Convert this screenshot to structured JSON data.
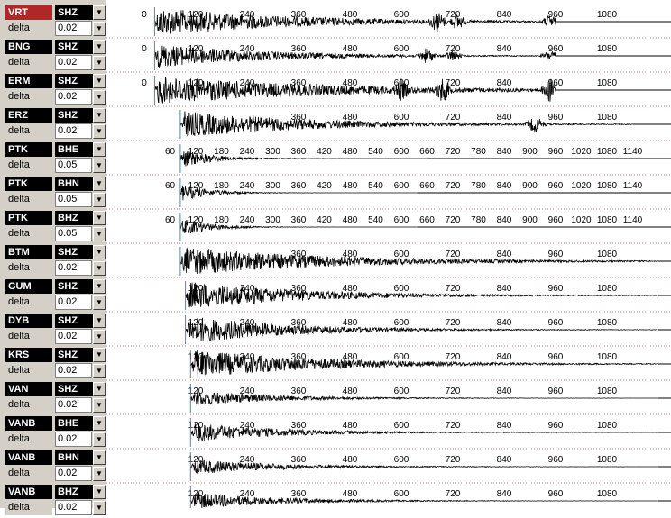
{
  "delta_label": "delta",
  "arrow_glyph": "▼",
  "channels": [
    {
      "station": "VRT",
      "component": "SHZ",
      "delta": "0.02",
      "selected": true
    },
    {
      "station": "BNG",
      "component": "SHZ",
      "delta": "0.02"
    },
    {
      "station": "ERM",
      "component": "SHZ",
      "delta": "0.02"
    },
    {
      "station": "ERZ",
      "component": "SHZ",
      "delta": "0.02"
    },
    {
      "station": "PTK",
      "component": "BHE",
      "delta": "0.05"
    },
    {
      "station": "PTK",
      "component": "BHN",
      "delta": "0.05"
    },
    {
      "station": "PTK",
      "component": "BHZ",
      "delta": "0.05"
    },
    {
      "station": "BTM",
      "component": "SHZ",
      "delta": "0.02"
    },
    {
      "station": "GUM",
      "component": "SHZ",
      "delta": "0.02"
    },
    {
      "station": "DYB",
      "component": "SHZ",
      "delta": "0.02"
    },
    {
      "station": "KRS",
      "component": "SHZ",
      "delta": "0.02"
    },
    {
      "station": "VAN",
      "component": "SHZ",
      "delta": "0.02"
    },
    {
      "station": "VANB",
      "component": "BHE",
      "delta": "0.02"
    },
    {
      "station": "VANB",
      "component": "BHN",
      "delta": "0.02"
    },
    {
      "station": "VANB",
      "component": "BHZ",
      "delta": "0.02"
    }
  ],
  "traces": [
    {
      "ticks": [
        "0",
        "120",
        "240",
        "360",
        "480",
        "600",
        "720",
        "840",
        "960",
        "1080"
      ],
      "onset": 0.02,
      "end": 0.8,
      "amp": 1.0,
      "decay": 0.55,
      "bursts": [
        [
          0.57,
          0.8
        ],
        [
          0.61,
          0.6
        ],
        [
          0.79,
          0.5
        ]
      ]
    },
    {
      "ticks": [
        "0",
        "120",
        "240",
        "360",
        "480",
        "600",
        "720",
        "840",
        "960",
        "1080"
      ],
      "onset": 0.02,
      "end": 0.8,
      "amp": 0.85,
      "decay": 0.45,
      "bursts": [
        [
          0.55,
          0.7
        ],
        [
          0.6,
          0.5
        ],
        [
          0.79,
          0.45
        ]
      ]
    },
    {
      "ticks": [
        "0",
        "120",
        "240",
        "360",
        "480",
        "600",
        "720",
        "840",
        "960",
        "1080"
      ],
      "onset": 0.02,
      "end": 0.8,
      "amp": 1.0,
      "decay": 0.7,
      "bursts": [
        [
          0.5,
          0.8
        ],
        [
          0.58,
          0.9
        ],
        [
          0.79,
          0.9
        ]
      ]
    },
    {
      "ticks": [
        "360",
        "480",
        "600",
        "720",
        "840",
        "960",
        "1080"
      ],
      "onset": 0.07,
      "end": 0.95,
      "amp": 0.95,
      "decay": 0.45,
      "bursts": [
        [
          0.76,
          0.6
        ]
      ]
    },
    {
      "ticks": [
        "60",
        "120",
        "180",
        "240",
        "300",
        "360",
        "420",
        "480",
        "540",
        "600",
        "660",
        "720",
        "780",
        "840",
        "900",
        "960",
        "1020",
        "1080",
        "1140"
      ],
      "onset": 0.07,
      "end": 0.55,
      "amp": 0.7,
      "decay": 0.2,
      "bursts": []
    },
    {
      "ticks": [
        "60",
        "120",
        "180",
        "240",
        "300",
        "360",
        "420",
        "480",
        "540",
        "600",
        "660",
        "720",
        "780",
        "840",
        "900",
        "960",
        "1020",
        "1080",
        "1140"
      ],
      "onset": 0.07,
      "end": 0.53,
      "amp": 0.6,
      "decay": 0.2,
      "bursts": []
    },
    {
      "ticks": [
        "60",
        "120",
        "180",
        "240",
        "300",
        "360",
        "420",
        "480",
        "540",
        "600",
        "660",
        "720",
        "780",
        "840",
        "900",
        "960",
        "1020",
        "1080",
        "1140"
      ],
      "onset": 0.07,
      "end": 0.53,
      "amp": 0.65,
      "decay": 0.2,
      "bursts": []
    },
    {
      "ticks": [
        "360",
        "480",
        "600",
        "720",
        "840",
        "960",
        "1080"
      ],
      "onset": 0.07,
      "end": 1.0,
      "amp": 1.0,
      "decay": 0.5,
      "bursts": []
    },
    {
      "ticks": [
        "120",
        "240",
        "360",
        "480",
        "600",
        "720",
        "840",
        "960",
        "1080"
      ],
      "onset": 0.08,
      "end": 1.0,
      "amp": 1.0,
      "decay": 0.4,
      "bursts": []
    },
    {
      "ticks": [
        "120",
        "240",
        "360",
        "480",
        "600",
        "720",
        "840",
        "960",
        "1080"
      ],
      "onset": 0.08,
      "end": 1.0,
      "amp": 1.0,
      "decay": 0.35,
      "bursts": []
    },
    {
      "ticks": [
        "120",
        "240",
        "360",
        "480",
        "600",
        "720",
        "840",
        "960",
        "1080"
      ],
      "onset": 0.09,
      "end": 1.0,
      "amp": 1.0,
      "decay": 0.45,
      "bursts": []
    },
    {
      "ticks": [
        "120",
        "240",
        "360",
        "480",
        "600",
        "720",
        "840",
        "960",
        "1080"
      ],
      "onset": 0.09,
      "end": 1.0,
      "amp": 0.55,
      "decay": 0.3,
      "bursts": []
    },
    {
      "ticks": [
        "120",
        "240",
        "360",
        "480",
        "600",
        "720",
        "840",
        "960",
        "1080"
      ],
      "onset": 0.09,
      "end": 1.0,
      "amp": 0.7,
      "decay": 0.3,
      "bursts": []
    },
    {
      "ticks": [
        "120",
        "240",
        "360",
        "480",
        "600",
        "720",
        "840",
        "960",
        "1080"
      ],
      "onset": 0.09,
      "end": 1.0,
      "amp": 0.55,
      "decay": 0.3,
      "bursts": []
    },
    {
      "ticks": [
        "120",
        "240",
        "360",
        "480",
        "600",
        "720",
        "840",
        "960",
        "1080"
      ],
      "onset": 0.09,
      "end": 1.0,
      "amp": 0.6,
      "decay": 0.3,
      "bursts": []
    }
  ]
}
